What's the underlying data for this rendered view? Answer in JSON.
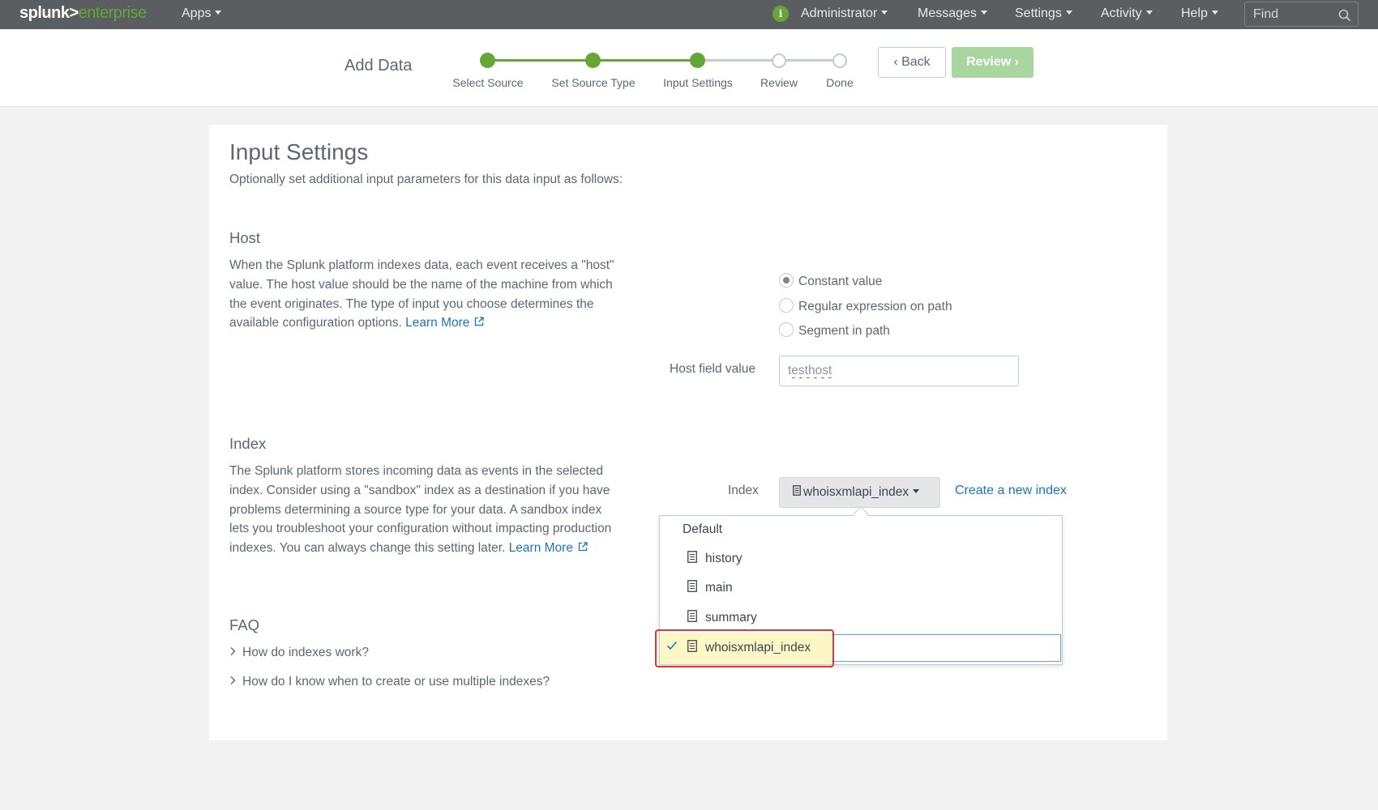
{
  "topbar": {
    "logo_part1": "splunk>",
    "logo_part2": "enterprise",
    "apps_label": "Apps",
    "nav": [
      "Administrator",
      "Messages",
      "Settings",
      "Activity",
      "Help"
    ],
    "find_placeholder": "Find",
    "info_icon": "info-icon",
    "accent_color": "#65a637"
  },
  "wizard": {
    "title": "Add Data",
    "steps": [
      {
        "label": "Select Source",
        "state": "done"
      },
      {
        "label": "Set Source Type",
        "state": "done"
      },
      {
        "label": "Input Settings",
        "state": "current"
      },
      {
        "label": "Review",
        "state": "todo"
      },
      {
        "label": "Done",
        "state": "todo"
      }
    ],
    "back_label": "Back",
    "review_label": "Review"
  },
  "page": {
    "title": "Input Settings",
    "subtitle": "Optionally set additional input parameters for this data input as follows:"
  },
  "host": {
    "heading": "Host",
    "description": "When the Splunk platform indexes data, each event receives a \"host\" value. The host value should be the name of the machine from which the event originates. The type of input you choose determines the available configuration options.",
    "learn_more": "Learn More",
    "radio_options": [
      {
        "label": "Constant value",
        "selected": true
      },
      {
        "label": "Regular expression on path",
        "selected": false
      },
      {
        "label": "Segment in path",
        "selected": false
      }
    ],
    "field_label": "Host field value",
    "field_value": "testhost"
  },
  "index": {
    "heading": "Index",
    "description": "The Splunk platform stores incoming data as events in the selected index. Consider using a \"sandbox\" index as a destination if you have problems determining a source type for your data. A sandbox index lets you troubleshoot your configuration without impacting production indexes. You can always change this setting later.",
    "learn_more": "Learn More",
    "field_label": "Index",
    "selected_value": "whoisxmlapi_index",
    "create_link": "Create a new index",
    "dropdown": {
      "group_label": "Default",
      "items": [
        "history",
        "main",
        "summary",
        "whoisxmlapi_index"
      ],
      "selected_index": 3
    }
  },
  "faq": {
    "heading": "FAQ",
    "items": [
      "How do indexes work?",
      "How do I know when to create or use multiple indexes?"
    ]
  }
}
